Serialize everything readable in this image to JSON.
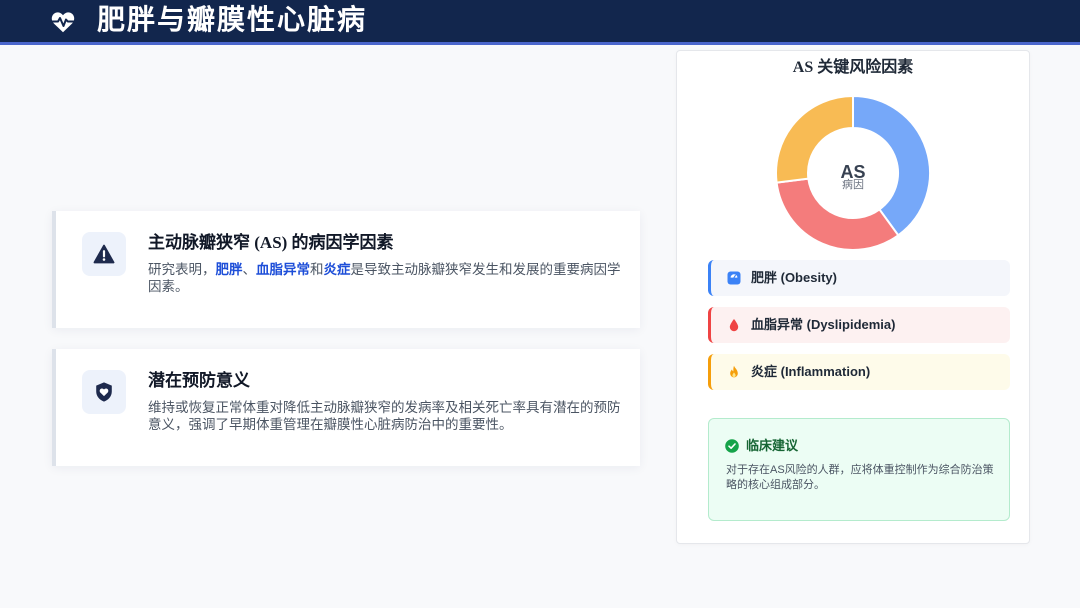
{
  "header": {
    "title": "肥胖与瓣膜性心脏病",
    "icon": "heart-pulse-icon"
  },
  "cards": [
    {
      "icon": "warning-triangle-icon",
      "title": "主动脉瓣狭窄 (AS) 的病因学因素",
      "body": [
        "研究表明，",
        "肥胖",
        "、",
        "血脂异常",
        "和",
        "炎症",
        "是导致主动脉瓣狭窄发生和发展的重要病因学因素。"
      ]
    },
    {
      "icon": "shield-heart-icon",
      "title": "潜在预防意义",
      "body": [
        "维持或恢复正常体重对降低主动脉瓣狭窄的发病率及相关死亡率具有潜在的预防意义，强调了早期体重管理在瓣膜性心脏病防治中的重要性。"
      ]
    }
  ],
  "chart_data": {
    "type": "pie",
    "donut": true,
    "title": "AS 关键风险因素",
    "center_label": "AS",
    "center_sublabel": "病因",
    "categories": [
      "肥胖 (Obesity)",
      "血脂异常 (Dyslipidemia)",
      "炎症 (Inflammation)"
    ],
    "values": [
      40,
      33,
      27
    ],
    "colors": [
      "#76a8f9",
      "#f47c7c",
      "#f8bb54"
    ],
    "legend": "bottom"
  },
  "risk_panel": {
    "factors": [
      {
        "icon": "weight-scale-icon",
        "accent": "#3b82f6",
        "background": "#f4f6fb"
      },
      {
        "icon": "droplet-icon",
        "accent": "#ef4444",
        "background": "#fdf1f1"
      },
      {
        "icon": "fire-icon",
        "accent": "#f59e0b",
        "background": "#fefbea"
      }
    ],
    "advice": {
      "icon": "check-circle-icon",
      "title": "临床建议",
      "text": "对于存在AS风险的人群，应将体重控制作为综合防治策略的核心组成部分。"
    }
  },
  "theme": {
    "header_bg": "#12264d",
    "header_accent": "#4a66cc",
    "highlight": "#1d4ed8"
  }
}
